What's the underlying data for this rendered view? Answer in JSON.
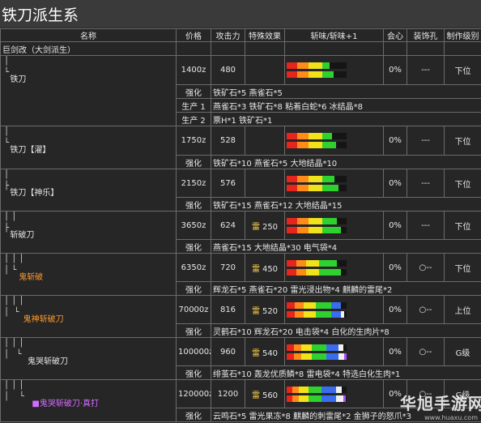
{
  "title": "铁刀派生系",
  "headers": [
    "名称",
    "价格",
    "攻击力",
    "特殊效果",
    "斩味/斩味+1",
    "会心",
    "装饰孔",
    "制作级别"
  ],
  "root": "巨剑改（大剑派生）",
  "colors": {
    "red": "#e8251c",
    "orange": "#ff8c1a",
    "yellow": "#f2e21a",
    "green": "#2fd12f",
    "blue": "#3a6cf0",
    "white": "#f0f0f0",
    "purple": "#b24cff"
  },
  "weapons": [
    {
      "guides": "│\n└",
      "name": "铁刀",
      "name_color": "white",
      "price": "1400z",
      "attack": "480",
      "special": "",
      "special_icon": "",
      "affinity": "0%",
      "slots": "---",
      "level": "下位",
      "sharp1": [
        [
          "red",
          0.18
        ],
        [
          "orange",
          0.18
        ],
        [
          "yellow",
          0.24
        ],
        [
          "green",
          0.12
        ]
      ],
      "sharp2": [
        [
          "red",
          0.18
        ],
        [
          "orange",
          0.18
        ],
        [
          "yellow",
          0.24
        ],
        [
          "green",
          0.18
        ]
      ],
      "recipes": [
        [
          "强化",
          "lbl-orange",
          "铁矿石*5 燕雀石*5"
        ],
        [
          "生产 1",
          "lbl-green",
          "燕雀石*3 铁矿石*8 粘着白蛇*6 冰结晶*8"
        ],
        [
          "生产 2",
          "lbl-green",
          "票H*1 铁矿石*1"
        ]
      ]
    },
    {
      "guides": "│\n└",
      "name": "铁刀【濯】",
      "name_color": "white",
      "price": "1750z",
      "attack": "528",
      "special": "",
      "special_icon": "",
      "affinity": "0%",
      "slots": "---",
      "level": "下位",
      "sharp1": [
        [
          "red",
          0.18
        ],
        [
          "orange",
          0.18
        ],
        [
          "yellow",
          0.24
        ],
        [
          "green",
          0.16
        ]
      ],
      "sharp2": [
        [
          "red",
          0.18
        ],
        [
          "orange",
          0.18
        ],
        [
          "yellow",
          0.24
        ],
        [
          "green",
          0.22
        ]
      ],
      "recipes": [
        [
          "强化",
          "lbl-orange",
          "铁矿石*10 燕雀石*5 大地结晶*10"
        ]
      ]
    },
    {
      "guides": "│\n├",
      "name": "铁刀【神乐】",
      "name_color": "white",
      "price": "2150z",
      "attack": "576",
      "special": "",
      "special_icon": "",
      "affinity": "0%",
      "slots": "---",
      "level": "下位",
      "sharp1": [
        [
          "red",
          0.18
        ],
        [
          "orange",
          0.18
        ],
        [
          "yellow",
          0.24
        ],
        [
          "green",
          0.2
        ]
      ],
      "sharp2": [
        [
          "red",
          0.18
        ],
        [
          "orange",
          0.18
        ],
        [
          "yellow",
          0.24
        ],
        [
          "green",
          0.26
        ]
      ],
      "recipes": [
        [
          "强化",
          "lbl-orange",
          "铁矿石*15 燕雀石*12 大地结晶*15"
        ]
      ]
    },
    {
      "guides": "│ │\n├",
      "name": "斩破刀",
      "name_color": "white",
      "price": "3650z",
      "attack": "624",
      "special": "250",
      "special_icon": "雷",
      "affinity": "0%",
      "slots": "---",
      "level": "下位",
      "sharp1": [
        [
          "red",
          0.18
        ],
        [
          "orange",
          0.18
        ],
        [
          "yellow",
          0.24
        ],
        [
          "green",
          0.24
        ]
      ],
      "sharp2": [
        [
          "red",
          0.18
        ],
        [
          "orange",
          0.18
        ],
        [
          "yellow",
          0.24
        ],
        [
          "green",
          0.3
        ]
      ],
      "recipes": [
        [
          "强化",
          "lbl-orange",
          "燕雀石*15 大地结晶*30 电气袋*4"
        ]
      ]
    },
    {
      "guides": "│ │ │\n│ └",
      "name": "鬼斩破",
      "name_color": "orange",
      "price": "6350z",
      "attack": "720",
      "special": "450",
      "special_icon": "雷",
      "affinity": "0%",
      "slots": "○--",
      "level": "下位",
      "sharp1": [
        [
          "red",
          0.16
        ],
        [
          "orange",
          0.16
        ],
        [
          "yellow",
          0.22
        ],
        [
          "green",
          0.3
        ]
      ],
      "sharp2": [
        [
          "red",
          0.16
        ],
        [
          "orange",
          0.16
        ],
        [
          "yellow",
          0.22
        ],
        [
          "green",
          0.36
        ]
      ],
      "recipes": [
        [
          "强化",
          "lbl-orange",
          "辉龙石*5 燕雀石*20 雷光浸出物*4 麒麟的雷尾*2"
        ]
      ]
    },
    {
      "guides": "│ │ │\n│  └",
      "name": "鬼神斩破刀",
      "name_color": "orange",
      "price": "70000z",
      "attack": "816",
      "special": "520",
      "special_icon": "雷",
      "affinity": "0%",
      "slots": "○--",
      "level": "上位",
      "sharp1": [
        [
          "red",
          0.14
        ],
        [
          "orange",
          0.14
        ],
        [
          "yellow",
          0.2
        ],
        [
          "green",
          0.26
        ],
        [
          "blue",
          0.16
        ]
      ],
      "sharp2": [
        [
          "red",
          0.14
        ],
        [
          "orange",
          0.14
        ],
        [
          "yellow",
          0.2
        ],
        [
          "green",
          0.26
        ],
        [
          "blue",
          0.16
        ],
        [
          "white",
          0.06
        ]
      ],
      "recipes": [
        [
          "强化",
          "lbl-orange",
          "灵鹤石*10 辉龙石*20 电击袋*4 白化的生肉片*8"
        ]
      ]
    },
    {
      "guides": "│ │ │\n│   └",
      "name": "鬼哭斩破刀",
      "name_color": "white",
      "price": "100000z",
      "attack": "960",
      "special": "540",
      "special_icon": "雷",
      "affinity": "0%",
      "slots": "○--",
      "level": "G级",
      "sharp1": [
        [
          "red",
          0.12
        ],
        [
          "orange",
          0.12
        ],
        [
          "yellow",
          0.18
        ],
        [
          "green",
          0.24
        ],
        [
          "blue",
          0.2
        ],
        [
          "white",
          0.08
        ]
      ],
      "sharp2": [
        [
          "red",
          0.12
        ],
        [
          "orange",
          0.12
        ],
        [
          "yellow",
          0.18
        ],
        [
          "green",
          0.24
        ],
        [
          "blue",
          0.2
        ],
        [
          "white",
          0.1
        ],
        [
          "purple",
          0.04
        ]
      ],
      "recipes": [
        [
          "强化",
          "lbl-orange",
          "绯茧石*10 轰龙优质鳞*8 雷电袋*4 特选白化生肉*1"
        ]
      ]
    },
    {
      "guides": "│ │ │\n│    └",
      "name": "■鬼哭斩破刀·真打",
      "name_color": "purple",
      "price": "120000z",
      "attack": "1200",
      "special": "560",
      "special_icon": "雷",
      "affinity": "0%",
      "slots": "○--",
      "level": "G级",
      "sharp1": [
        [
          "red",
          0.1
        ],
        [
          "orange",
          0.1
        ],
        [
          "yellow",
          0.16
        ],
        [
          "green",
          0.22
        ],
        [
          "blue",
          0.24
        ],
        [
          "white",
          0.1
        ]
      ],
      "sharp2": [
        [
          "red",
          0.1
        ],
        [
          "orange",
          0.1
        ],
        [
          "yellow",
          0.16
        ],
        [
          "green",
          0.22
        ],
        [
          "blue",
          0.24
        ],
        [
          "white",
          0.12
        ],
        [
          "purple",
          0.04
        ]
      ],
      "recipes": [
        [
          "强化",
          "lbl-orange",
          "云鸣石*5 雷光果冻*8 麒麟的刺雷尾*2 金狮子的怒爪*3"
        ]
      ]
    }
  ],
  "watermark": {
    "logo": "华旭手游网",
    "url": "www.huaxu.com"
  }
}
